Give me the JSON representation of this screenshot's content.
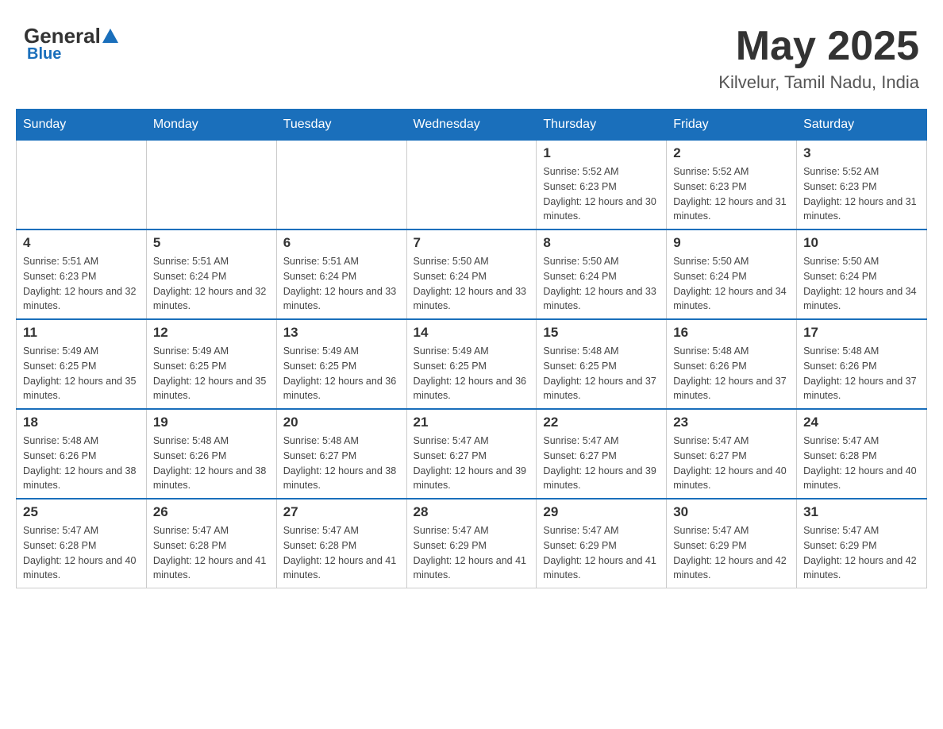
{
  "header": {
    "logo_general": "General",
    "logo_blue": "Blue",
    "month_title": "May 2025",
    "location": "Kilvelur, Tamil Nadu, India"
  },
  "days_of_week": [
    "Sunday",
    "Monday",
    "Tuesday",
    "Wednesday",
    "Thursday",
    "Friday",
    "Saturday"
  ],
  "weeks": [
    [
      {
        "day": "",
        "info": ""
      },
      {
        "day": "",
        "info": ""
      },
      {
        "day": "",
        "info": ""
      },
      {
        "day": "",
        "info": ""
      },
      {
        "day": "1",
        "info": "Sunrise: 5:52 AM\nSunset: 6:23 PM\nDaylight: 12 hours and 30 minutes."
      },
      {
        "day": "2",
        "info": "Sunrise: 5:52 AM\nSunset: 6:23 PM\nDaylight: 12 hours and 31 minutes."
      },
      {
        "day": "3",
        "info": "Sunrise: 5:52 AM\nSunset: 6:23 PM\nDaylight: 12 hours and 31 minutes."
      }
    ],
    [
      {
        "day": "4",
        "info": "Sunrise: 5:51 AM\nSunset: 6:23 PM\nDaylight: 12 hours and 32 minutes."
      },
      {
        "day": "5",
        "info": "Sunrise: 5:51 AM\nSunset: 6:24 PM\nDaylight: 12 hours and 32 minutes."
      },
      {
        "day": "6",
        "info": "Sunrise: 5:51 AM\nSunset: 6:24 PM\nDaylight: 12 hours and 33 minutes."
      },
      {
        "day": "7",
        "info": "Sunrise: 5:50 AM\nSunset: 6:24 PM\nDaylight: 12 hours and 33 minutes."
      },
      {
        "day": "8",
        "info": "Sunrise: 5:50 AM\nSunset: 6:24 PM\nDaylight: 12 hours and 33 minutes."
      },
      {
        "day": "9",
        "info": "Sunrise: 5:50 AM\nSunset: 6:24 PM\nDaylight: 12 hours and 34 minutes."
      },
      {
        "day": "10",
        "info": "Sunrise: 5:50 AM\nSunset: 6:24 PM\nDaylight: 12 hours and 34 minutes."
      }
    ],
    [
      {
        "day": "11",
        "info": "Sunrise: 5:49 AM\nSunset: 6:25 PM\nDaylight: 12 hours and 35 minutes."
      },
      {
        "day": "12",
        "info": "Sunrise: 5:49 AM\nSunset: 6:25 PM\nDaylight: 12 hours and 35 minutes."
      },
      {
        "day": "13",
        "info": "Sunrise: 5:49 AM\nSunset: 6:25 PM\nDaylight: 12 hours and 36 minutes."
      },
      {
        "day": "14",
        "info": "Sunrise: 5:49 AM\nSunset: 6:25 PM\nDaylight: 12 hours and 36 minutes."
      },
      {
        "day": "15",
        "info": "Sunrise: 5:48 AM\nSunset: 6:25 PM\nDaylight: 12 hours and 37 minutes."
      },
      {
        "day": "16",
        "info": "Sunrise: 5:48 AM\nSunset: 6:26 PM\nDaylight: 12 hours and 37 minutes."
      },
      {
        "day": "17",
        "info": "Sunrise: 5:48 AM\nSunset: 6:26 PM\nDaylight: 12 hours and 37 minutes."
      }
    ],
    [
      {
        "day": "18",
        "info": "Sunrise: 5:48 AM\nSunset: 6:26 PM\nDaylight: 12 hours and 38 minutes."
      },
      {
        "day": "19",
        "info": "Sunrise: 5:48 AM\nSunset: 6:26 PM\nDaylight: 12 hours and 38 minutes."
      },
      {
        "day": "20",
        "info": "Sunrise: 5:48 AM\nSunset: 6:27 PM\nDaylight: 12 hours and 38 minutes."
      },
      {
        "day": "21",
        "info": "Sunrise: 5:47 AM\nSunset: 6:27 PM\nDaylight: 12 hours and 39 minutes."
      },
      {
        "day": "22",
        "info": "Sunrise: 5:47 AM\nSunset: 6:27 PM\nDaylight: 12 hours and 39 minutes."
      },
      {
        "day": "23",
        "info": "Sunrise: 5:47 AM\nSunset: 6:27 PM\nDaylight: 12 hours and 40 minutes."
      },
      {
        "day": "24",
        "info": "Sunrise: 5:47 AM\nSunset: 6:28 PM\nDaylight: 12 hours and 40 minutes."
      }
    ],
    [
      {
        "day": "25",
        "info": "Sunrise: 5:47 AM\nSunset: 6:28 PM\nDaylight: 12 hours and 40 minutes."
      },
      {
        "day": "26",
        "info": "Sunrise: 5:47 AM\nSunset: 6:28 PM\nDaylight: 12 hours and 41 minutes."
      },
      {
        "day": "27",
        "info": "Sunrise: 5:47 AM\nSunset: 6:28 PM\nDaylight: 12 hours and 41 minutes."
      },
      {
        "day": "28",
        "info": "Sunrise: 5:47 AM\nSunset: 6:29 PM\nDaylight: 12 hours and 41 minutes."
      },
      {
        "day": "29",
        "info": "Sunrise: 5:47 AM\nSunset: 6:29 PM\nDaylight: 12 hours and 41 minutes."
      },
      {
        "day": "30",
        "info": "Sunrise: 5:47 AM\nSunset: 6:29 PM\nDaylight: 12 hours and 42 minutes."
      },
      {
        "day": "31",
        "info": "Sunrise: 5:47 AM\nSunset: 6:29 PM\nDaylight: 12 hours and 42 minutes."
      }
    ]
  ]
}
